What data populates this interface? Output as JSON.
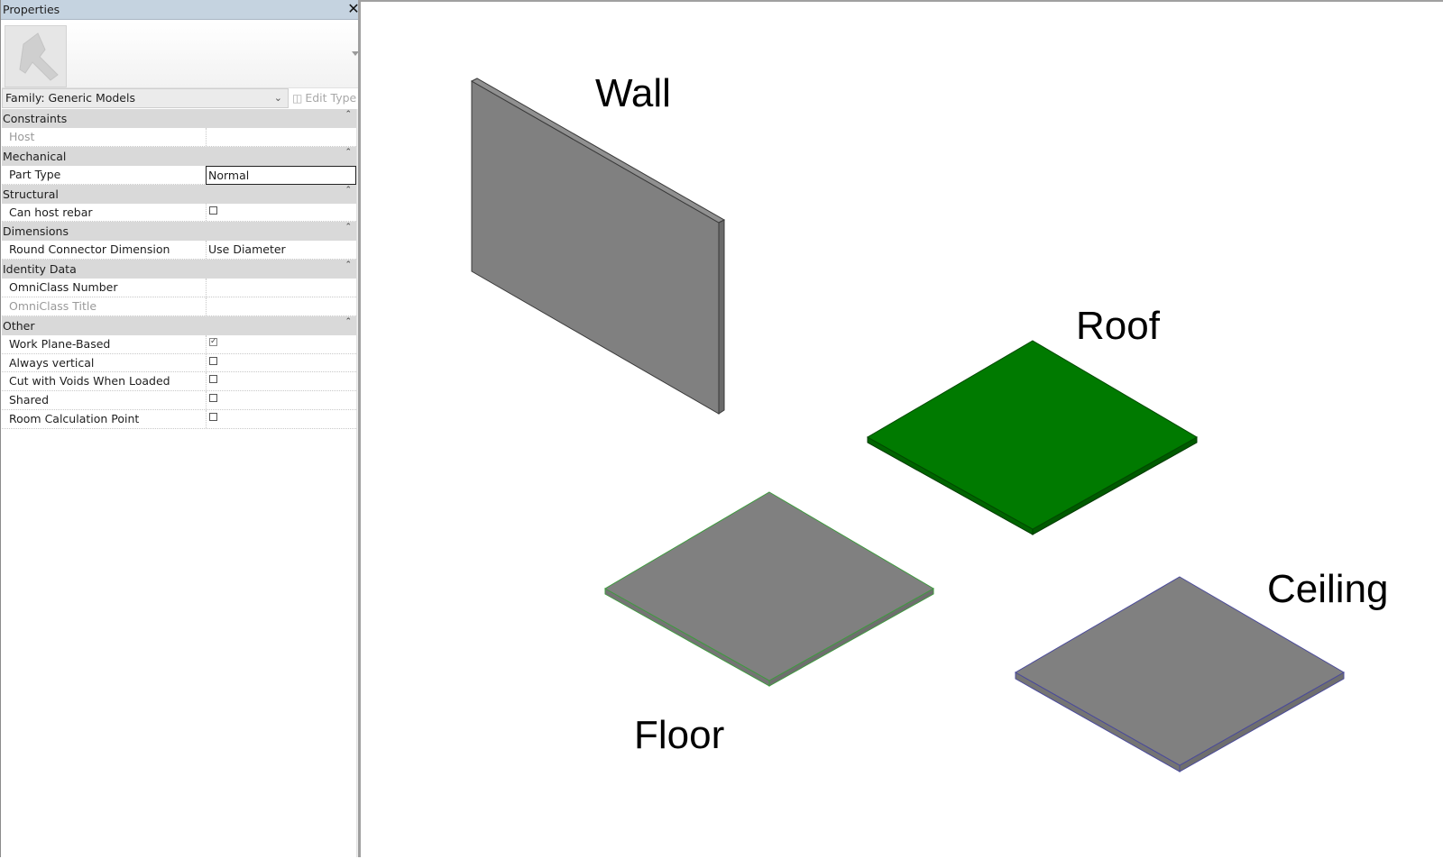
{
  "panel": {
    "title": "Properties",
    "close_icon": "close-icon",
    "type_thumbnail_icon": "revit-family-icon",
    "family_selector": "Family: Generic Models",
    "edit_type_label": "Edit Type",
    "edit_type_icon": "edit-type-icon"
  },
  "groups": [
    {
      "label": "Constraints",
      "rows": [
        {
          "name": "Host",
          "value": "",
          "type": "text",
          "muted": true
        }
      ]
    },
    {
      "label": "Mechanical",
      "rows": [
        {
          "name": "Part Type",
          "value": "Normal",
          "type": "dropdown-active"
        }
      ]
    },
    {
      "label": "Structural",
      "rows": [
        {
          "name": "Can host rebar",
          "type": "checkbox",
          "checked": false
        }
      ]
    },
    {
      "label": "Dimensions",
      "rows": [
        {
          "name": "Round Connector Dimension",
          "value": "Use Diameter",
          "type": "text"
        }
      ]
    },
    {
      "label": "Identity Data",
      "rows": [
        {
          "name": "OmniClass Number",
          "value": "",
          "type": "text"
        },
        {
          "name": "OmniClass Title",
          "value": "",
          "type": "text",
          "muted": true
        }
      ]
    },
    {
      "label": "Other",
      "rows": [
        {
          "name": "Work Plane-Based",
          "type": "checkbox",
          "checked": true
        },
        {
          "name": "Always vertical",
          "type": "checkbox",
          "checked": false
        },
        {
          "name": "Cut with Voids When Loaded",
          "type": "checkbox",
          "checked": false
        },
        {
          "name": "Shared",
          "type": "checkbox",
          "checked": false
        },
        {
          "name": "Room Calculation Point",
          "type": "checkbox",
          "checked": false
        }
      ]
    }
  ],
  "viewport": {
    "objects": [
      {
        "label": "Wall",
        "kind": "wall",
        "fill": "#808080",
        "edge": "#3a3a3a"
      },
      {
        "label": "Roof",
        "kind": "slab",
        "fill": "#007a00",
        "edge": "#004a00"
      },
      {
        "label": "Floor",
        "kind": "slab",
        "fill": "#808080",
        "edge": "#3f9a3f"
      },
      {
        "label": "Ceiling",
        "kind": "slab",
        "fill": "#808080",
        "edge": "#4a4a9a"
      }
    ]
  }
}
